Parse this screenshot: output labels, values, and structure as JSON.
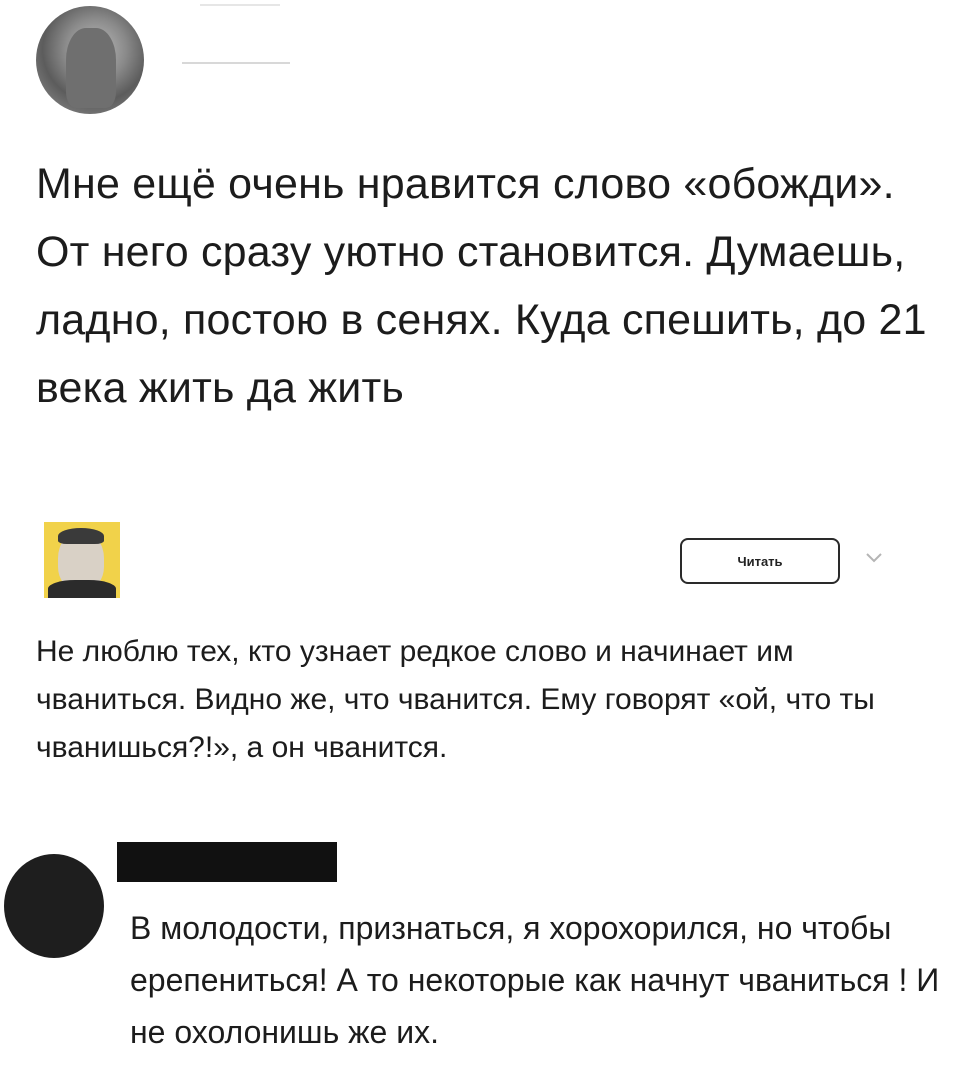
{
  "post1": {
    "text": "Мне ещё очень нравится слово «обожди». От него сразу уютно становится. Думаешь, ладно, постою в сенях. Куда спешить, до 21 века жить да жить"
  },
  "post2": {
    "read_button_label": "Читать",
    "chevron_icon": "chevron-down-icon",
    "text": "Не люблю тех, кто узнает редкое слово и начинает им чваниться. Видно же, что чванится. Ему говорят «ой, что ты чванишься?!», а он чванится."
  },
  "post3": {
    "text": "В молодости, признаться, я хорохорился, но чтобы ерепениться! А то некоторые как начнут чваниться ! И не охолонишь же их."
  },
  "colors": {
    "avatar2_background": "#f1d24a",
    "redaction": "#111111"
  }
}
